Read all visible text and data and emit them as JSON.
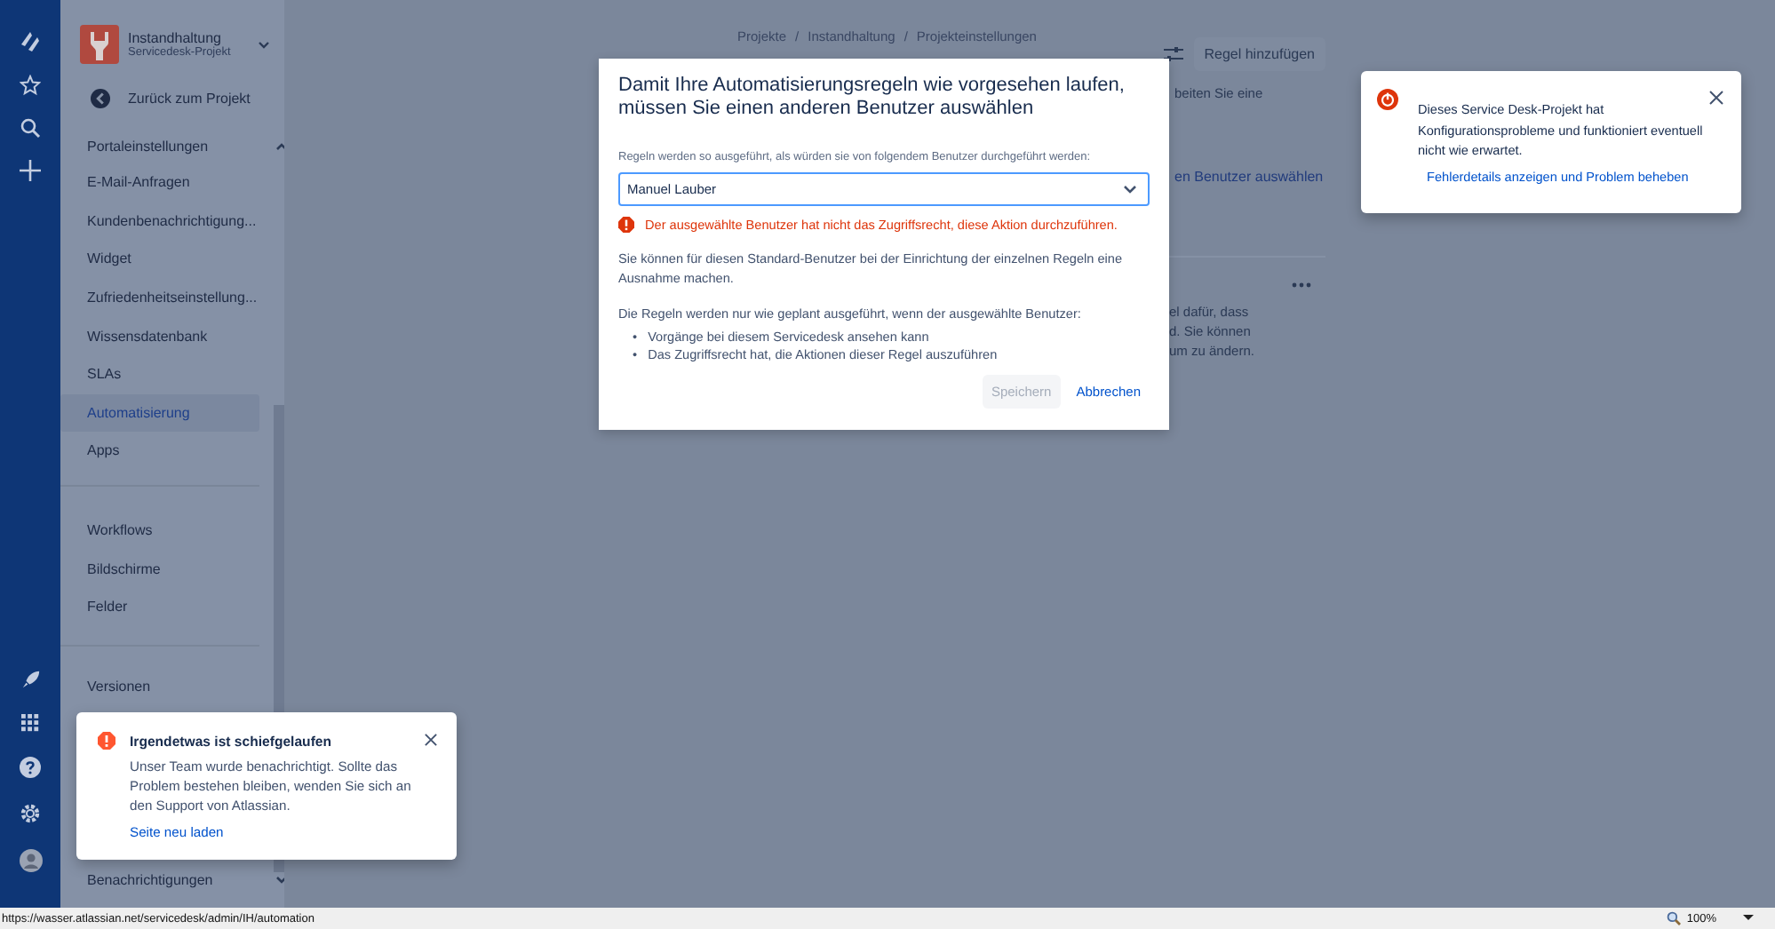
{
  "sidebar": {
    "project": {
      "name": "Instandhaltung",
      "type": "Servicedesk-Projekt"
    },
    "back_link": "Zurück zum Projekt",
    "groups": [
      {
        "heading": "Portaleinstellungen",
        "expanded": true,
        "items": [
          {
            "label": "E-Mail-Anfragen",
            "selected": false
          },
          {
            "label": "Kundenbenachrichtigung...",
            "selected": false
          },
          {
            "label": "Widget",
            "selected": false
          },
          {
            "label": "Zufriedenheitseinstellung...",
            "selected": false
          },
          {
            "label": "Wissensdatenbank",
            "selected": false
          },
          {
            "label": "SLAs",
            "selected": false
          },
          {
            "label": "Automatisierung",
            "selected": true
          },
          {
            "label": "Apps",
            "selected": false
          }
        ]
      },
      {
        "items": [
          {
            "label": "Workflows",
            "selected": false
          },
          {
            "label": "Bildschirme",
            "selected": false
          },
          {
            "label": "Felder",
            "selected": false
          }
        ]
      },
      {
        "items": [
          {
            "label": "Versionen",
            "selected": false
          }
        ]
      },
      {
        "heading": "Benachrichtigungen",
        "expanded": false
      }
    ]
  },
  "main": {
    "breadcrumbs": [
      "Projekte",
      "/",
      "Instandhaltung",
      "/",
      "Projekteinstellungen"
    ],
    "add_rule_button": "Regel hinzufügen",
    "intro_fragment": "beiten Sie eine",
    "user_link_fragment": "en Benutzer auswählen",
    "rule_card_fragments": [
      "el dafür, dass",
      "d. Sie können",
      "um zu ändern."
    ]
  },
  "modal": {
    "title": "Damit Ihre Automatisierungsregeln wie vorgesehen laufen, müssen Sie einen anderen Benutzer auswählen",
    "field_label": "Regeln werden so ausgeführt, als würden sie von folgendem Benutzer durchgeführt werden:",
    "user_select": "Manuel Lauber",
    "error": "Der ausgewählte Benutzer hat nicht das Zugriffsrecht, diese Aktion durchzuführen.",
    "paragraphs": [
      "Sie können für diesen Standard-Benutzer bei der Einrichtung der einzelnen Regeln eine Ausnahme machen.",
      "Die Regeln werden nur wie geplant ausgeführt, wenn der ausgewählte Benutzer:"
    ],
    "bullets": [
      {
        "marker": "•",
        "text": "Vorgänge bei diesem Servicedesk ansehen kann"
      },
      {
        "marker": "•",
        "text": "Das Zugriffsrecht hat, die Aktionen dieser Regel auszuführen"
      }
    ],
    "save_button": {
      "label": "Speichern",
      "disabled": true
    },
    "cancel_button": "Abbrechen"
  },
  "config_flag": {
    "message": "Dieses Service Desk-Projekt hat Konfigurationsprobleme und funktioniert eventuell nicht wie erwartet.",
    "link": "Fehlerdetails anzeigen und Problem beheben"
  },
  "error_flag": {
    "title": "Irgendetwas ist schiefgelaufen",
    "message": "Unser Team wurde benachrichtigt. Sollte das Problem bestehen bleiben, wenden Sie sich an den Support von Atlassian.",
    "link": "Seite neu laden"
  },
  "status_bar": {
    "url": "https://wasser.atlassian.net/servicedesk/admin/IH/automation",
    "zoom": "100%"
  }
}
